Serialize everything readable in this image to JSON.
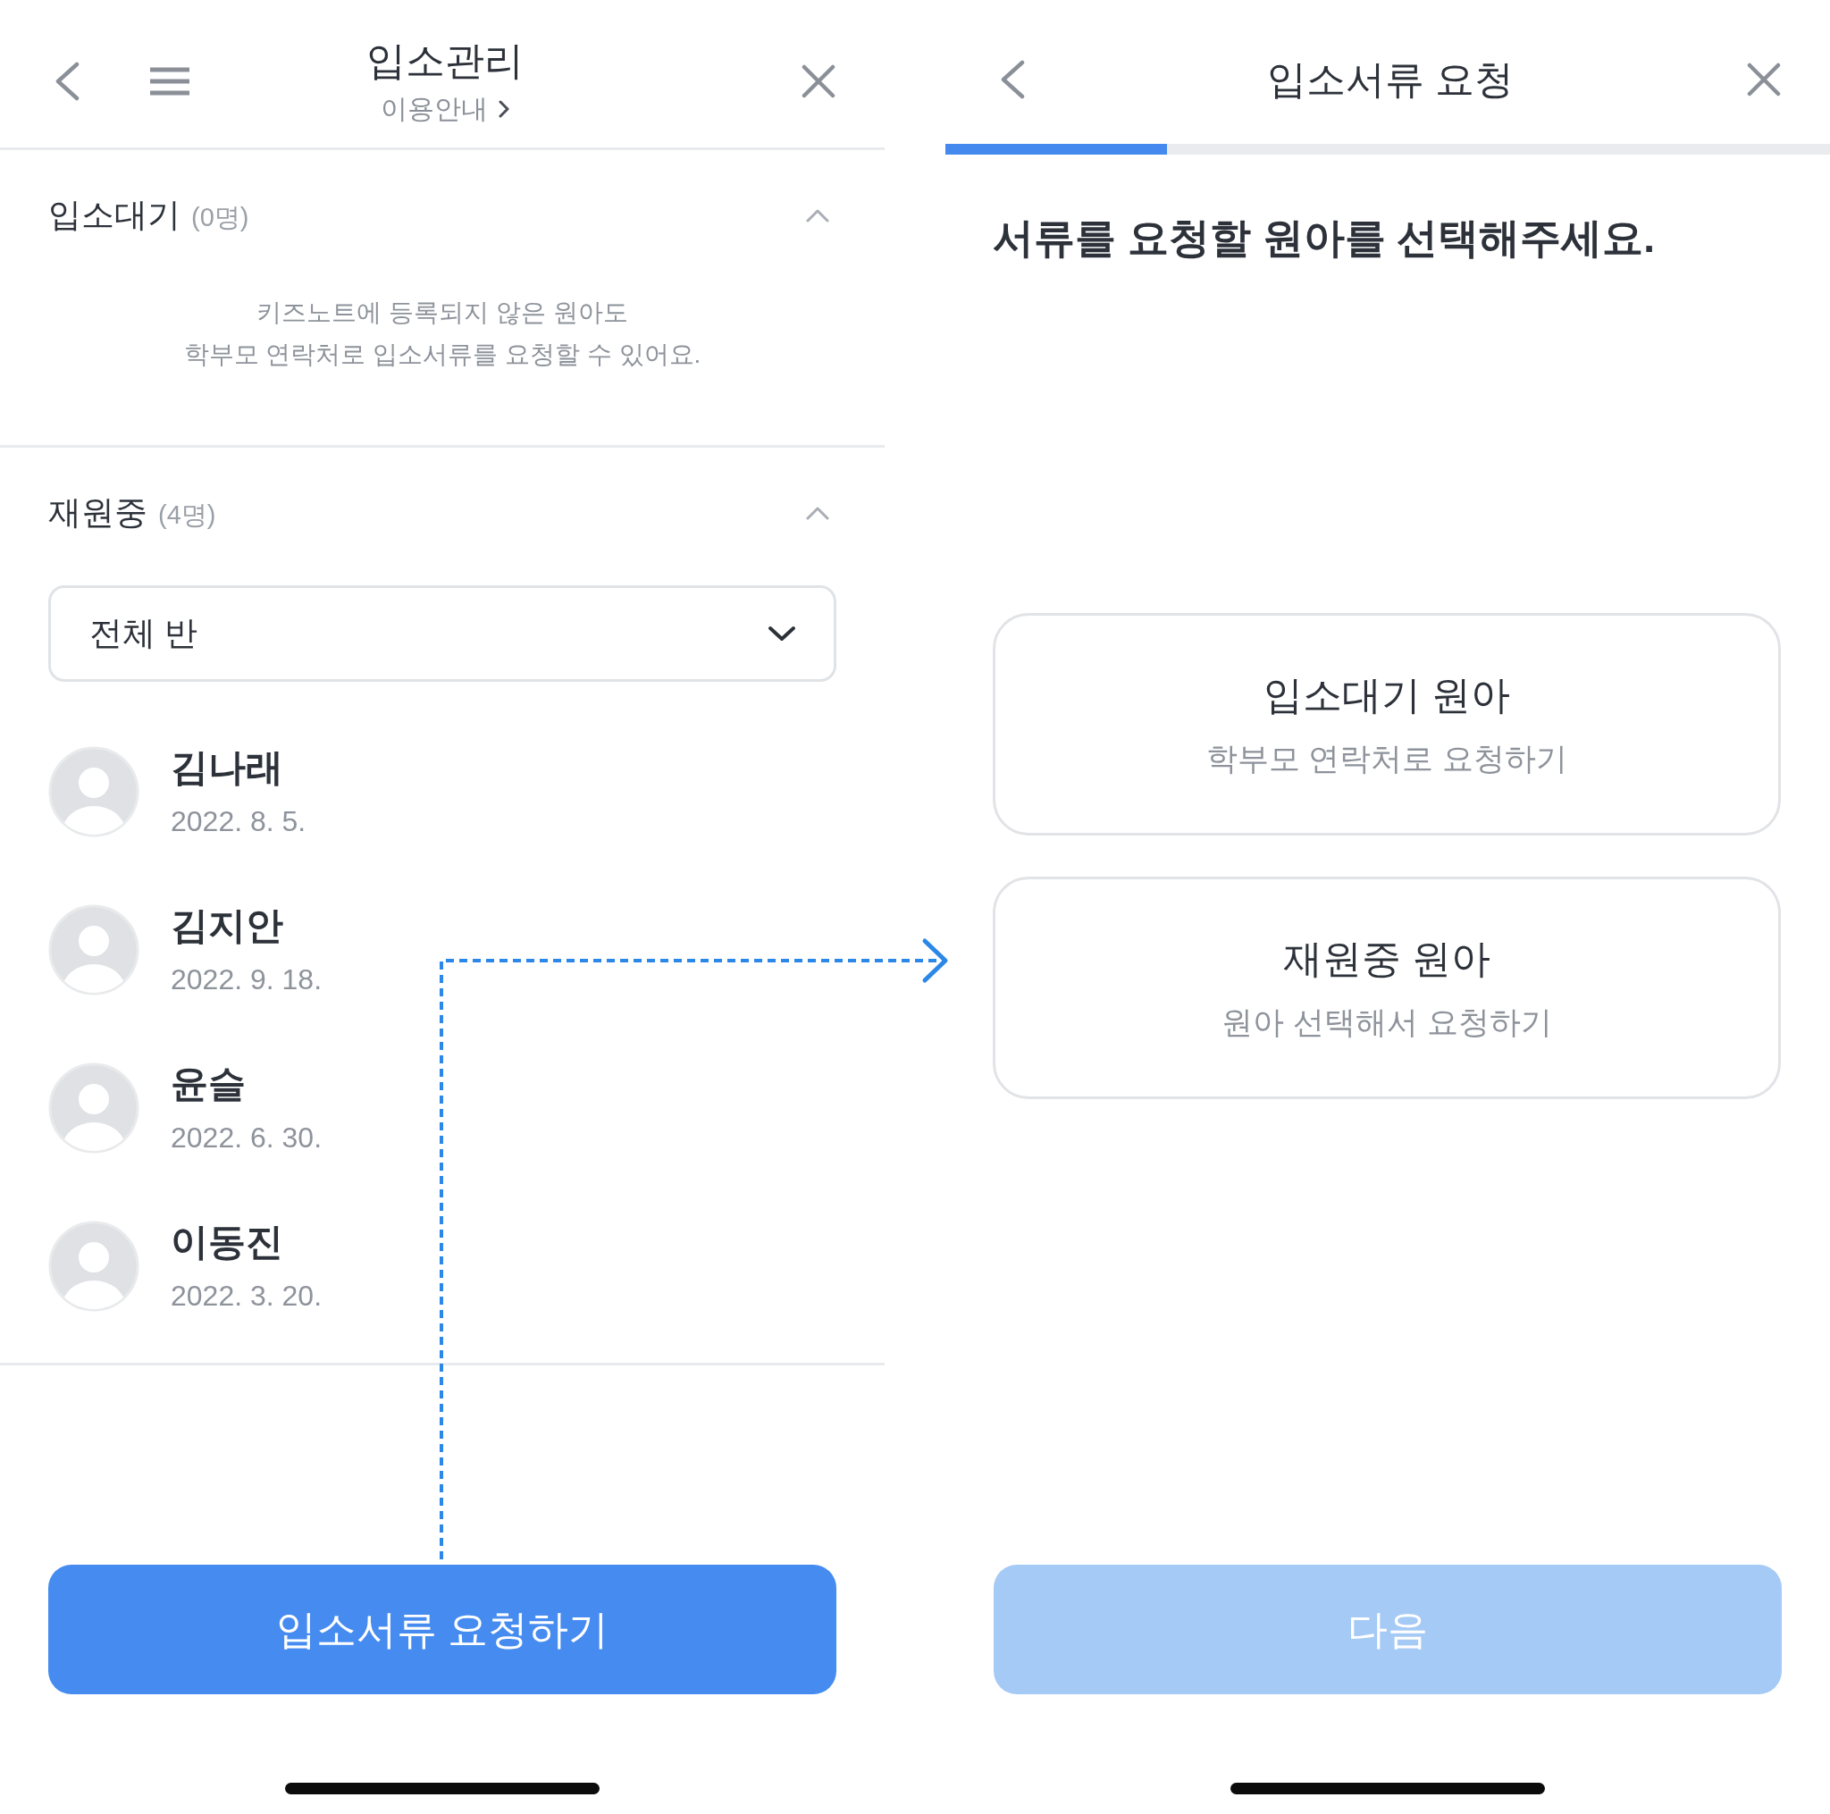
{
  "left_screen": {
    "header": {
      "title": "입소관리",
      "guide_link": "이용안내"
    },
    "sections": [
      {
        "title": "입소대기",
        "count": "(0명)",
        "expanded": true,
        "empty_message": "키즈노트에 등록되지 않은 원아도\n학부모 연락처로 입소서류를 요청할 수 있어요."
      },
      {
        "title": "재원중",
        "count": "(4명)",
        "expanded": true,
        "class_filter": {
          "value": "전체 반"
        },
        "students": [
          {
            "name": "김나래",
            "date": "2022. 8. 5."
          },
          {
            "name": "김지안",
            "date": "2022. 9. 18."
          },
          {
            "name": "윤슬",
            "date": "2022. 6. 30."
          },
          {
            "name": "이동진",
            "date": "2022. 3. 20."
          }
        ]
      }
    ],
    "request_button": {
      "label": "입소서류 요청하기"
    }
  },
  "right_screen": {
    "header": {
      "title": "입소서류 요청"
    },
    "progress": {
      "level": 0.25
    },
    "heading": "서류를 요청할 원아를 선택해주세요.",
    "options": [
      {
        "title": "입소대기 원아",
        "subtitle": "학부모 연락처로 요청하기",
        "selected": false
      },
      {
        "title": "재원중 원아",
        "subtitle": "원아 선택해서 요청하기",
        "selected": false
      }
    ],
    "next_button": {
      "label": "다음",
      "disabled": true
    }
  }
}
